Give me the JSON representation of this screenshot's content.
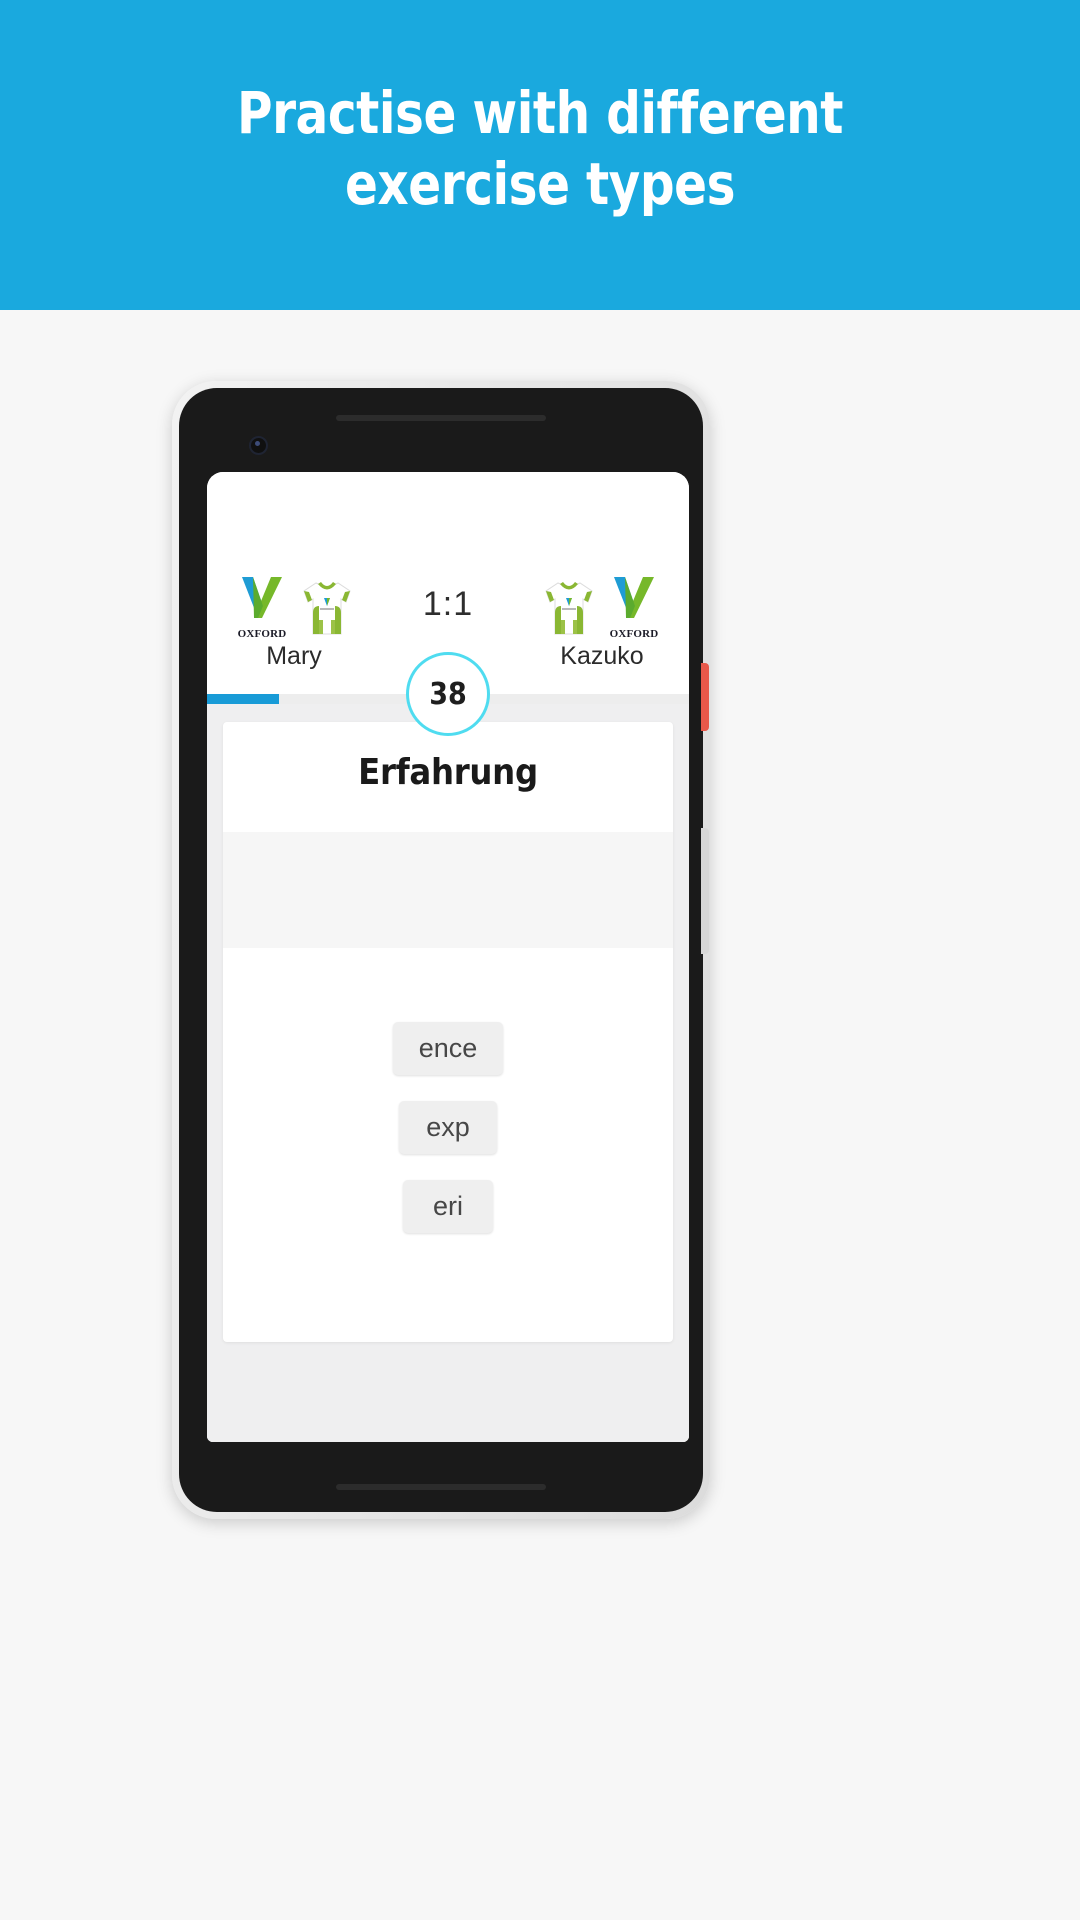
{
  "banner": {
    "title": "Practise with different\nexercise types",
    "background_color": "#1aa9de",
    "text_color": "#ffffff"
  },
  "page": {
    "background_color": "#f7f7f7"
  },
  "phone": {
    "frame_color": "#e8e8e8",
    "bezel_color": "#1a1a1a",
    "power_button_color": "#e8584a",
    "volume_button_color": "#d7d7d7"
  },
  "app": {
    "match": {
      "score": "1:1",
      "left_player": {
        "name": "Mary",
        "brand_label": "OXFORD",
        "logo_icon": "oxford-check-logo",
        "avatar_icon": "jersey-avatar"
      },
      "right_player": {
        "name": "Kazuko",
        "brand_label": "OXFORD",
        "logo_icon": "oxford-check-logo",
        "avatar_icon": "jersey-avatar"
      }
    },
    "timer": {
      "value": "38",
      "ring_color": "#4fdcf0"
    },
    "progress": {
      "percent": 15,
      "fill_color": "#189bd7",
      "track_color": "#ededed"
    },
    "exercise": {
      "prompt_word": "Erfahrung",
      "answer_slot_value": "",
      "tiles": [
        {
          "label": "ence"
        },
        {
          "label": "exp"
        },
        {
          "label": "eri"
        }
      ]
    }
  }
}
